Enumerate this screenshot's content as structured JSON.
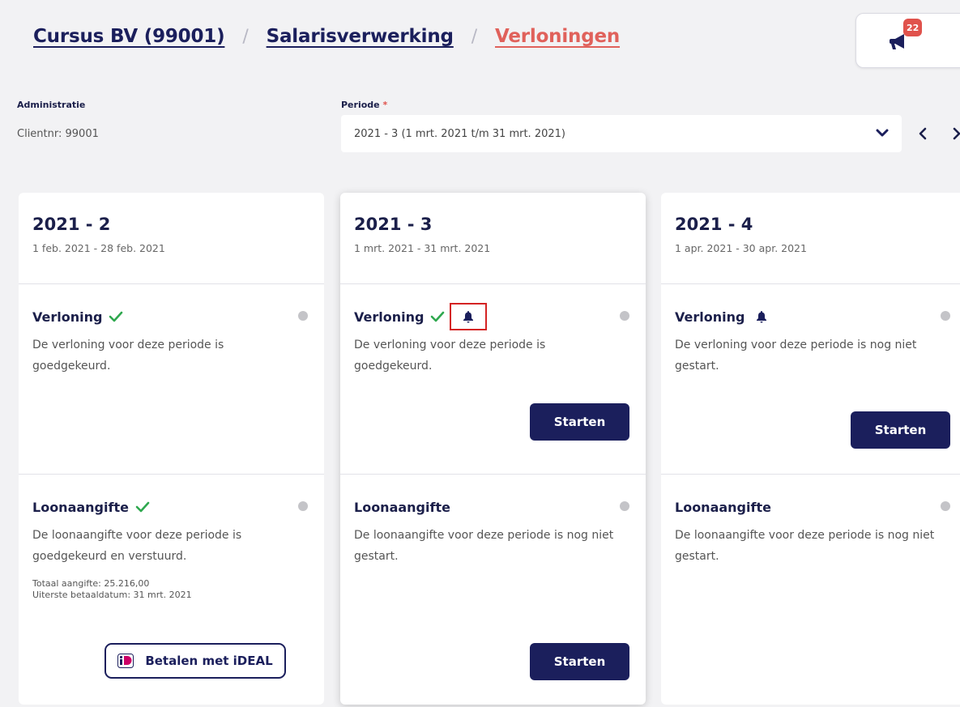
{
  "breadcrumb": {
    "items": [
      "Cursus BV (99001)",
      "Salarisverwerking",
      "Verloningen"
    ],
    "separator": "/"
  },
  "notifications": {
    "count": "22",
    "icon": "megaphone-icon"
  },
  "filters": {
    "administratie_label": "Administratie",
    "administratie_value": "Clientnr: 99001",
    "periode_label": "Periode",
    "periode_required_mark": "*",
    "periode_value": "2021 - 3 (1 mrt. 2021 t/m 31 mrt. 2021)"
  },
  "cards": [
    {
      "title": "2021 - 2",
      "range": "1 feb. 2021 - 28 feb. 2021",
      "verloning": {
        "title": "Verloning",
        "approved": true,
        "desc": "De verloning voor deze periode is goedgekeurd."
      },
      "loon": {
        "title": "Loonaangifte",
        "approved": true,
        "desc": "De loonaangifte voor deze periode is goedgekeurd en verstuurd.",
        "totaal": "Totaal aangifte:  25.216,00",
        "betaaldatum": "Uiterste betaaldatum:  31 mrt. 2021",
        "ideal_button": "Betalen met iDEAL"
      }
    },
    {
      "title": "2021 - 3",
      "range": "1 mrt. 2021 - 31 mrt. 2021",
      "verloning": {
        "title": "Verloning",
        "approved": true,
        "desc": "De verloning voor deze periode is goedgekeurd.",
        "button": "Starten"
      },
      "loon": {
        "title": "Loonaangifte",
        "desc": "De loonaangifte voor deze periode is nog niet gestart.",
        "button": "Starten"
      }
    },
    {
      "title": "2021 - 4",
      "range": "1 apr. 2021 - 30 apr. 2021",
      "verloning": {
        "title": "Verloning",
        "desc": "De verloning voor deze periode is nog niet gestart.",
        "button": "Starten"
      },
      "loon": {
        "title": "Loonaangifte",
        "desc": "De loonaangifte voor deze periode is nog niet gestart."
      }
    }
  ],
  "colors": {
    "navy": "#1b1f5c",
    "active_crumb": "#e0615b",
    "check_green": "#2fa84f",
    "highlight_red": "#d42323",
    "badge_red": "#e0524c"
  }
}
